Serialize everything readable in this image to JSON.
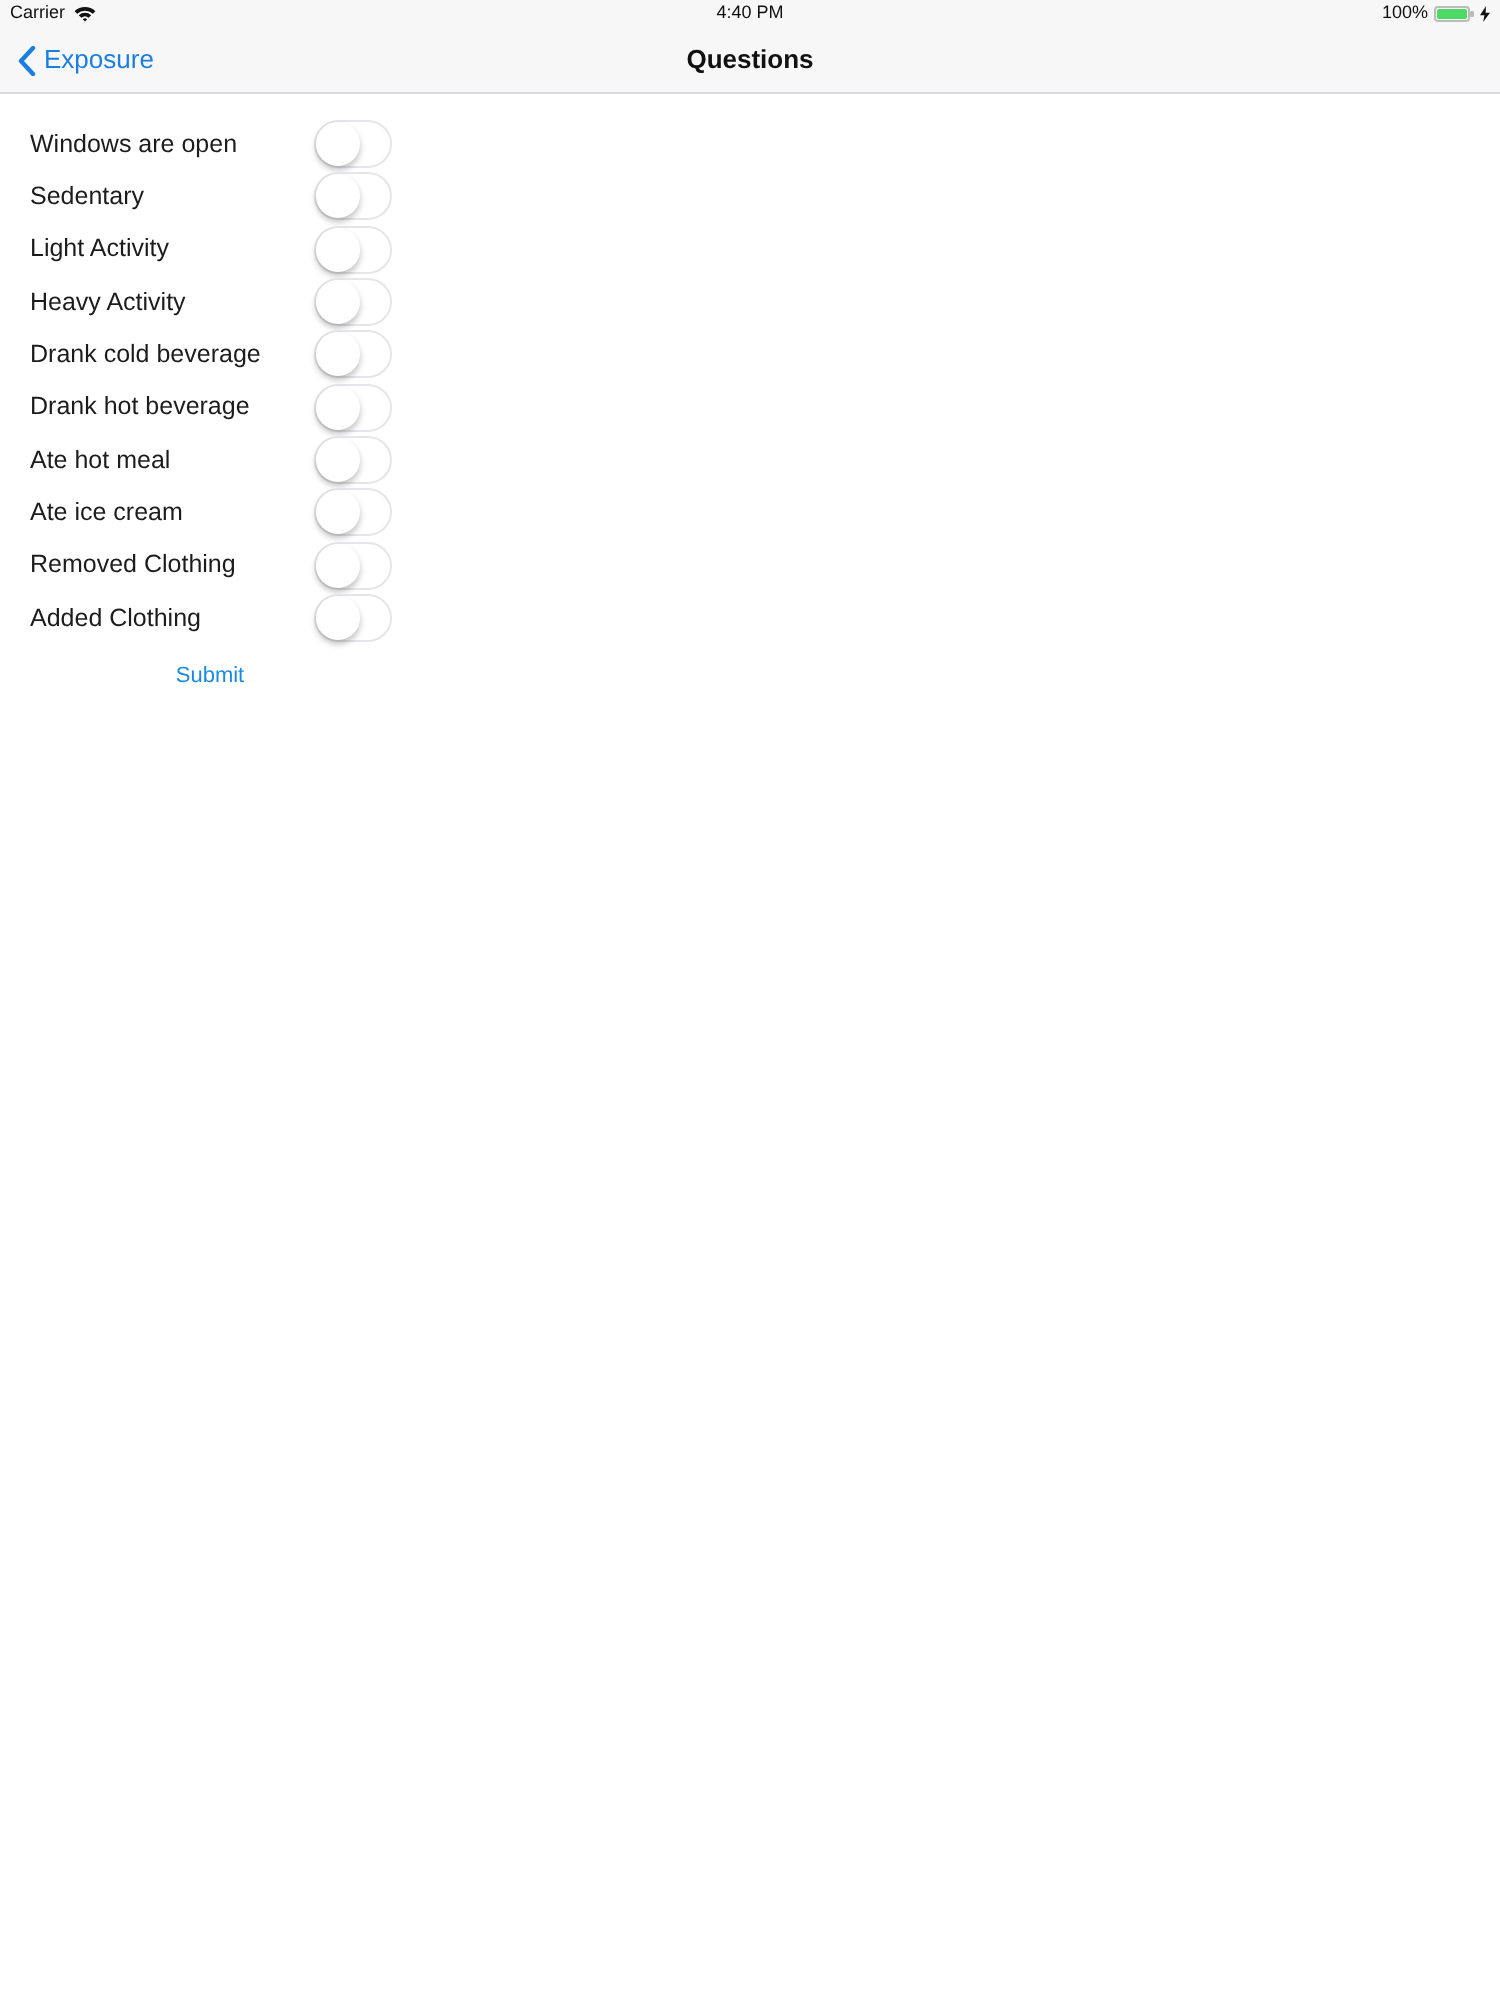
{
  "status_bar": {
    "carrier": "Carrier",
    "time": "4:40 PM",
    "battery": "100%"
  },
  "nav_bar": {
    "back": "Exposure",
    "title": "Questions"
  },
  "questions": [
    {
      "label": "Windows are open",
      "on": false
    },
    {
      "label": "Sedentary",
      "on": false
    },
    {
      "label": "Light Activity",
      "on": false
    },
    {
      "label": "Heavy Activity",
      "on": false
    },
    {
      "label": "Drank cold beverage",
      "on": false
    },
    {
      "label": "Drank hot beverage",
      "on": false
    },
    {
      "label": "Ate hot meal",
      "on": false
    },
    {
      "label": "Ate ice cream",
      "on": false
    },
    {
      "label": "Removed Clothing",
      "on": false
    },
    {
      "label": "Added Clothing",
      "on": false
    }
  ],
  "submit": "Submit"
}
